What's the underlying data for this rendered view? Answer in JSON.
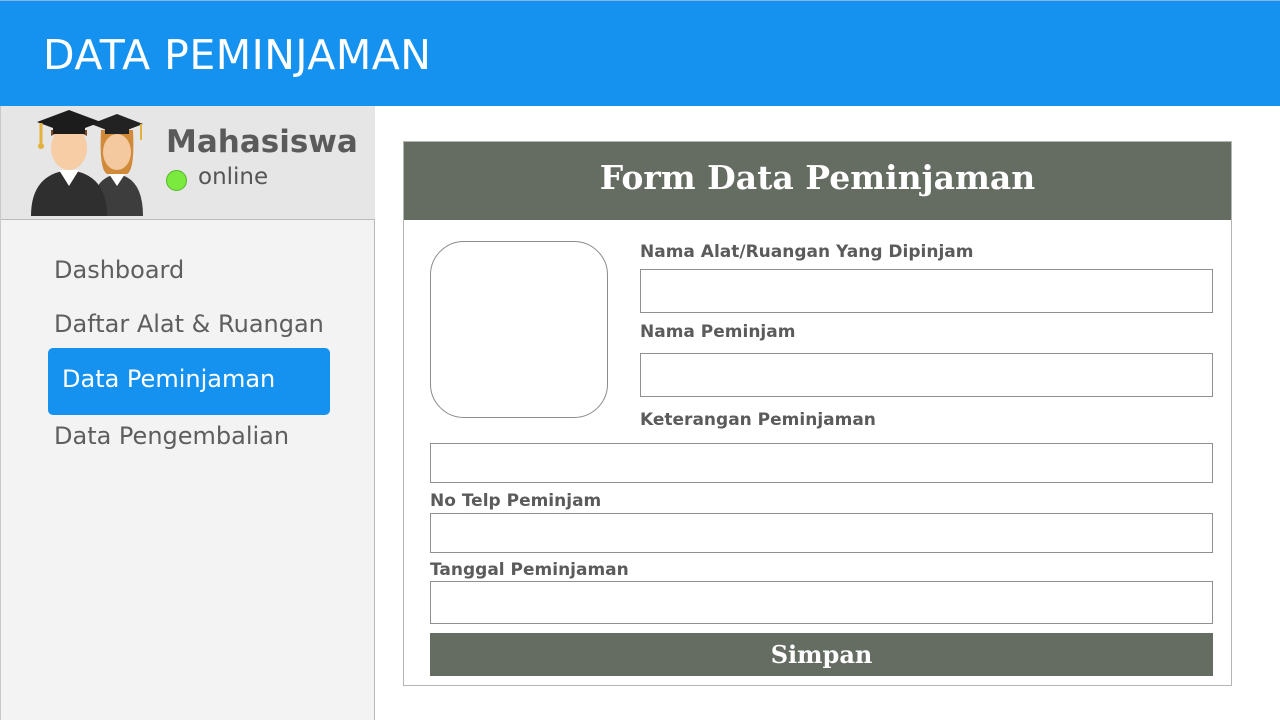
{
  "header": {
    "title": "DATA PEMINJAMAN"
  },
  "profile": {
    "name": "Mahasiswa",
    "status": "online",
    "status_color": "#7bea3e",
    "avatar_icon": "graduates-icon"
  },
  "sidebar": {
    "items": [
      {
        "label": "Dashboard",
        "active": false
      },
      {
        "label": "Daftar Alat & Ruangan",
        "active": false
      },
      {
        "label": "Data Peminjaman",
        "active": true
      },
      {
        "label": "Data Pengembalian",
        "active": false
      }
    ]
  },
  "form": {
    "title": "Form Data Peminjaman",
    "fields": {
      "nama_alat": {
        "label": "Nama Alat/Ruangan Yang Dipinjam",
        "value": ""
      },
      "nama_peminjam": {
        "label": "Nama Peminjam",
        "value": ""
      },
      "keterangan": {
        "label": "Keterangan Peminjaman",
        "value": ""
      },
      "no_telp": {
        "label": "No Telp Peminjam",
        "value": ""
      },
      "tanggal": {
        "label": "Tanggal Peminjaman",
        "value": ""
      }
    },
    "submit_label": "Simpan"
  },
  "colors": {
    "accent": "#1591f0",
    "form_header": "#656c62"
  }
}
